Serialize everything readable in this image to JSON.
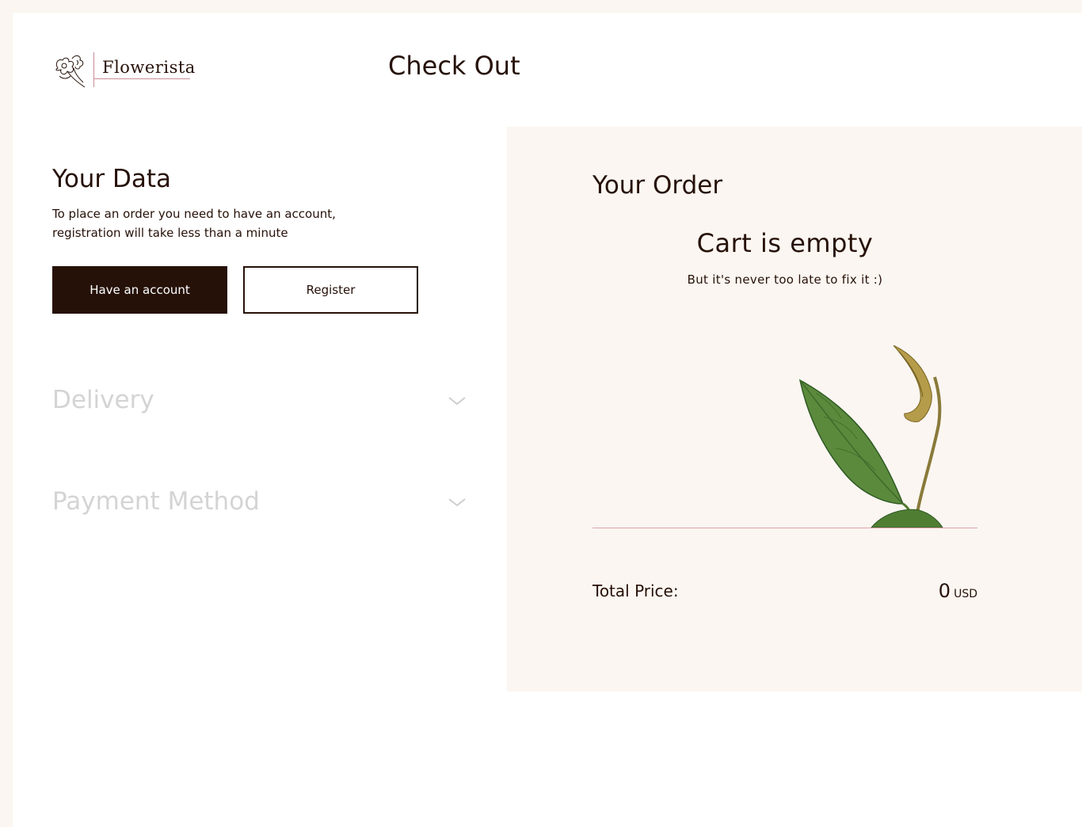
{
  "header": {
    "brand_name": "Flowerista",
    "page_title": "Check Out"
  },
  "your_data": {
    "title": "Your Data",
    "description": "To place an order you need to have an account, registration will take less than a minute",
    "have_account_label": "Have an account",
    "register_label": "Register"
  },
  "sections": {
    "delivery_label": "Delivery",
    "payment_label": "Payment Method"
  },
  "order": {
    "title": "Your Order",
    "empty_title": "Cart is empty",
    "empty_subtitle": "But it's never too late to fix it :)",
    "total_label": "Total Price:",
    "total_value": "0",
    "currency": "USD"
  },
  "colors": {
    "dark_brown": "#261108",
    "cream": "#fbf6f1",
    "accent_pink": "#e0a2ab",
    "muted_gray": "#d4d4d4"
  },
  "icons": {
    "logo": "flower-sketch-icon",
    "accordion": "chevron-down-icon",
    "illustration": "leaf-illustration"
  }
}
